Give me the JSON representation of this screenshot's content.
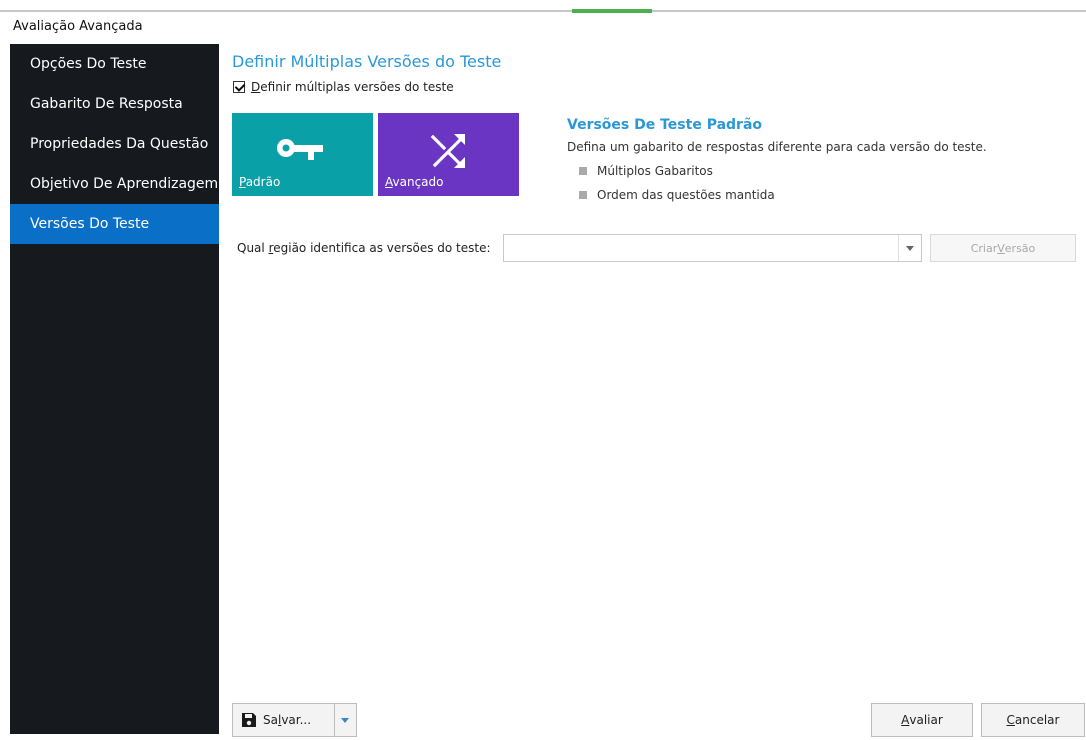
{
  "window": {
    "title": "Avaliação Avançada"
  },
  "colors": {
    "sidebar_bg": "#16191e",
    "accent_blue": "#0a6fc7",
    "teal_tile": "#0aa0a8",
    "purple_tile": "#6a35c2",
    "heading": "#2b98d6"
  },
  "sidebar": {
    "items": [
      {
        "label": "Opções Do Teste"
      },
      {
        "label": "Gabarito De Resposta"
      },
      {
        "label": "Propriedades Da Questão"
      },
      {
        "label": "Objetivo De Aprendizagem"
      },
      {
        "label": "Versões Do Teste",
        "active": true
      }
    ]
  },
  "main": {
    "section_title": "Definir Múltiplas Versões do Teste",
    "checkbox": {
      "label_first": "D",
      "label_rest": "efinir múltiplas versões do teste",
      "checked": true
    },
    "tiles": [
      {
        "label_first": "P",
        "label_rest": "adrão",
        "icon": "key-icon"
      },
      {
        "label_first": "A",
        "label_rest": "vançado",
        "icon": "shuffle-icon"
      }
    ],
    "info": {
      "title": "Versões De Teste Padrão",
      "description": "Defina um gabarito de respostas diferente para cada versão do teste.",
      "bullets": [
        "Múltiplos Gabaritos",
        "Ordem das questões mantida"
      ]
    },
    "region": {
      "label_pre": "Qual ",
      "label_u": "r",
      "label_post": "egião identifica as versões do teste:",
      "value": ""
    },
    "create_version": {
      "label_pre": "Criar ",
      "label_u": "V",
      "label_post": "ersão"
    }
  },
  "footer": {
    "save": {
      "label_pre": "Sa",
      "label_u": "l",
      "label_post": "var..."
    },
    "evaluate": {
      "label_u": "A",
      "label_post": "valiar"
    },
    "cancel": {
      "label_u": "C",
      "label_post": "ancelar"
    }
  }
}
